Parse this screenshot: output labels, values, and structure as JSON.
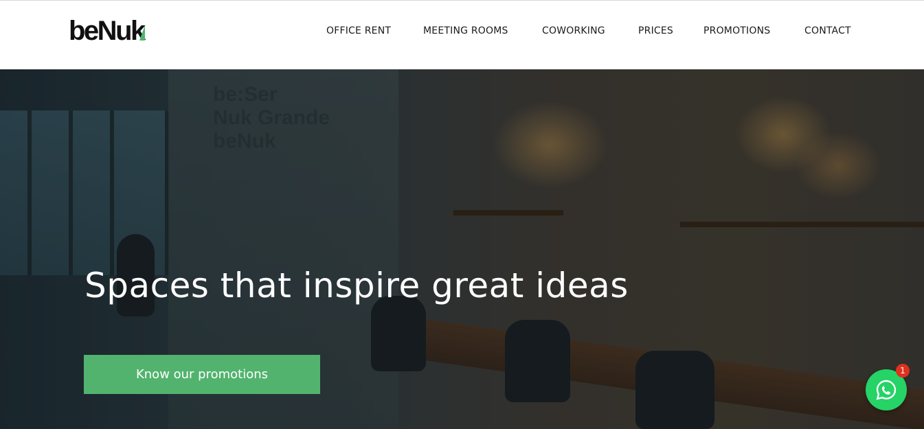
{
  "brand": {
    "logo_main": "beNu",
    "logo_end": "k",
    "accent_color": "#52b36e"
  },
  "nav": {
    "items": [
      {
        "label": "OFFICE RENT"
      },
      {
        "label": "MEETING ROOMS"
      },
      {
        "label": "COWORKING"
      },
      {
        "label": "PRICES"
      },
      {
        "label": "PROMOTIONS"
      },
      {
        "label": "CONTACT"
      }
    ]
  },
  "hero": {
    "headline": "Spaces that inspire great ideas",
    "cta_label": "Know our promotions",
    "cta_color": "#52b36e"
  },
  "chat_widget": {
    "icon": "whatsapp-icon",
    "badge_count": "1",
    "color": "#25d366"
  }
}
